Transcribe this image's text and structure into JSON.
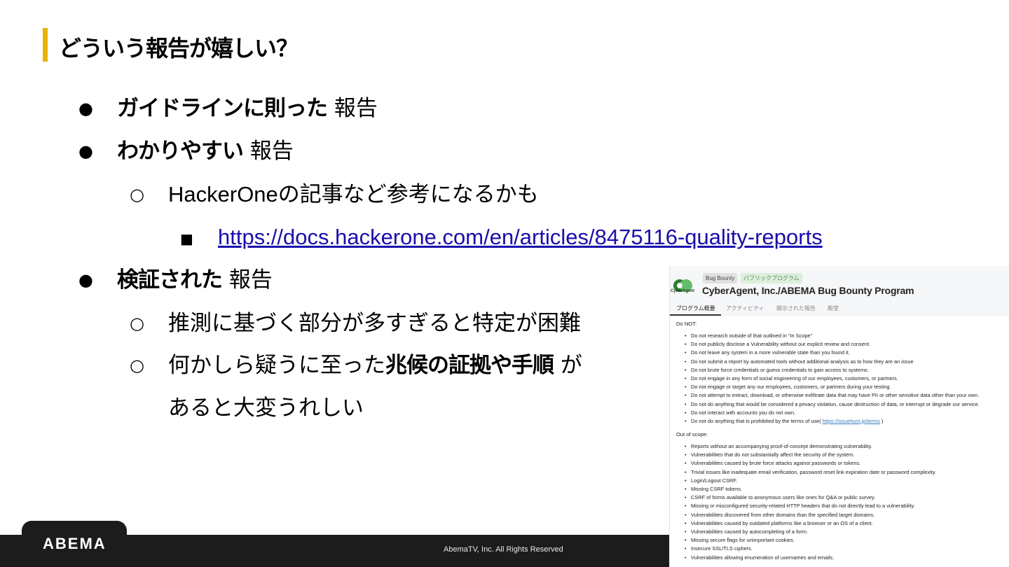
{
  "title": "どういう報告が嬉しい？",
  "bullets": {
    "b1": {
      "marker": "●",
      "bold": "ガイドラインに則った",
      "rest": " 報告"
    },
    "b2": {
      "marker": "●",
      "bold": "わかりやすい",
      "rest": " 報告"
    },
    "b2_sub": {
      "marker": "○",
      "text_a": "HackerOne",
      "text_b": "の記事など参考になるかも"
    },
    "b2_link": {
      "marker": "■",
      "url": "https://docs.hackerone.com/en/articles/8475116-quality-reports"
    },
    "b3": {
      "marker": "●",
      "bold": "検証された",
      "rest": " 報告"
    },
    "b3_sub1": {
      "marker": "○",
      "text": "推測に基づく部分が多すぎると特定が困難"
    },
    "b3_sub2": {
      "marker": "○",
      "text_a": "何かしら疑うに至った",
      "bold": "兆候の証拠や手順",
      "text_b": " が",
      "text_c": "あると大変うれしい"
    }
  },
  "footer": {
    "logo": "ABEMA",
    "copyright": "AbemaTV, Inc. All Rights Reserved"
  },
  "screenshot": {
    "logo_text": "CyberAgent",
    "badges": [
      "Bug Bounty",
      "パブリックプログラム"
    ],
    "program_title": "CyberAgent, Inc./ABEMA Bug Bounty Program",
    "tabs": [
      "プログラム概要",
      "アクティビティ",
      "開示された報告",
      "殿堂"
    ],
    "do_not_title": "Do NOT:",
    "do_not": [
      "Do not research outside of that outlined in \"In Scope\"",
      "Do not publicly disclose a Vulnerability without our explicit review and consent.",
      "Do not leave any system in a more vulnerable state than you found it.",
      "Do not submit a report by automated tools without additional analysis as to how they are an issue",
      "Do not brute force credentials or guess credentials to gain access to systems.",
      "Do not engage in any form of social engineering of our employees, customers, or partners.",
      "Do not engage or target any our employees, customers, or partners during your testing.",
      "Do not attempt to extract, download, or otherwise exfiltrate data that may have PII or other sensitive data other than your own.",
      "Do not do anything that would be considered a privacy violation, cause destruction of data, or interrupt or degrade our service.",
      "Do not interact with accounts you do not own."
    ],
    "do_not_last_text": "Do not do anything that is prohibited by the terms of use(",
    "do_not_last_link": "https://issuehunt.jp/terms",
    "do_not_last_close": " )",
    "out_of_scope_title": "Out of scope:",
    "out_of_scope": [
      "Reports without an accompanying proof-of-concept demonstrating vulnerability.",
      "Vulnerabilities that do not substantially affect the security of the system.",
      "Vulnerabilities caused by brute force attacks against passwords or tokens.",
      "Trivial issues like inadequate email verification, password reset link expiration date or password complexity.",
      "Login/Logout CSRF.",
      "Missing CSRF tokens.",
      "CSRF of forms available to anonymous users like ones for Q&A or public survey.",
      "Missing or misconfigured security-related HTTP headers that do not directly lead to a vulnerability.",
      "Vulnerabilities discovered from other domains than the specified target domains.",
      "Vulnerabilities caused by outdated platforms like a browser or an OS of a client.",
      "Vulnerabilities caused by autocompleting of a form.",
      "Missing secure flags for unimportant cookies.",
      "Insecure SSL/TLS ciphers.",
      "Vulnerabilities allowing enumeration of usernames and emails."
    ]
  }
}
